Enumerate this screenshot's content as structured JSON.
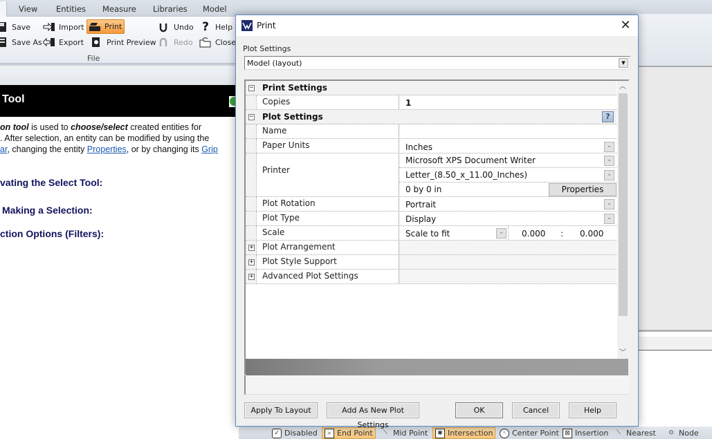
{
  "ribbon": {
    "tabs": [
      "View",
      "Entities",
      "Measure",
      "Libraries",
      "Model"
    ],
    "file_group": {
      "label": "File",
      "items": [
        {
          "label": "Save",
          "icon": "floppy-disk-icon"
        },
        {
          "label": "Save As",
          "icon": "floppy-disk-lines-icon"
        },
        {
          "label": "Import",
          "icon": "import-arrow-icon"
        },
        {
          "label": "Export",
          "icon": "export-arrow-icon"
        },
        {
          "label": "Print",
          "icon": "printer-icon",
          "highlighted": true
        },
        {
          "label": "Print Preview",
          "icon": "print-preview-magnifier-icon"
        },
        {
          "label": "Undo",
          "icon": "undo-arrow-icon"
        },
        {
          "label": "Redo",
          "icon": "redo-arrow-icon",
          "disabled": true
        },
        {
          "label": "Help",
          "icon": "question-mark-icon"
        },
        {
          "label": "Close",
          "icon": "close-folder-icon"
        }
      ]
    }
  },
  "help_panel": {
    "title": "Tool",
    "para_line1_em": "on tool",
    "para_line1_mid": " is used to ",
    "para_line1_em2": "choose/select",
    "para_line1_end": " created entities for",
    "para_line2": ". After selection, an entity can be modified by using the",
    "para_line3_link1": "ar",
    "para_line3_mid": ", changing the entity ",
    "para_line3_link2": "Properties",
    "para_line3_mid2": ", or by changing its ",
    "para_line3_link3": "Grip",
    "headings": [
      "vating the Select Tool:",
      "Making a Selection:",
      "ction Options (Filters):"
    ]
  },
  "dialog": {
    "title": "Print",
    "close_icon": "close-x-icon",
    "plot_settings_label": "Plot Settings",
    "plot_settings_value": "Model (layout)",
    "grid": {
      "categories": {
        "print_settings": "Print Settings",
        "plot_settings": "Plot Settings",
        "plot_arrangement": "Plot Arrangement",
        "plot_style_support": "Plot Style Support",
        "advanced_plot_settings": "Advanced Plot Settings"
      },
      "copies": {
        "name": "Copies",
        "value": "1"
      },
      "name": {
        "name": "Name",
        "value": ""
      },
      "paper_units": {
        "name": "Paper Units",
        "value": "Inches"
      },
      "printer": {
        "name": "Printer",
        "device": "Microsoft XPS Document Writer",
        "paper": "Letter_(8.50_x_11.00_Inches)",
        "size": "0 by 0 in",
        "properties_button": "Properties"
      },
      "plot_rotation": {
        "name": "Plot Rotation",
        "value": "Portrait"
      },
      "plot_type": {
        "name": "Plot Type",
        "value": "Display"
      },
      "scale": {
        "name": "Scale",
        "value": "Scale to fit",
        "num1": "0.000",
        "sep": ":",
        "num2": "0.000"
      },
      "help_icon_text": "?"
    },
    "buttons": {
      "apply_to_layout": "Apply To Layout",
      "add_as_new": "Add As New Plot Settings",
      "ok": "OK",
      "cancel": "Cancel",
      "help": "Help"
    }
  },
  "snap_bar": {
    "items": [
      {
        "label": "Disabled",
        "active": false
      },
      {
        "label": "End Point",
        "active": true
      },
      {
        "label": "Mid Point",
        "active": false
      },
      {
        "label": "Intersection",
        "active": true
      },
      {
        "label": "Center Point",
        "active": false
      },
      {
        "label": "Insertion",
        "active": false
      },
      {
        "label": "Nearest",
        "active": false
      },
      {
        "label": "Node",
        "active": false
      }
    ]
  },
  "colors": {
    "ribbon_highlight": "#f59a3a",
    "help_heading": "#13135e",
    "link": "#1a5bb3",
    "dialog_border": "#5b8cc8"
  }
}
